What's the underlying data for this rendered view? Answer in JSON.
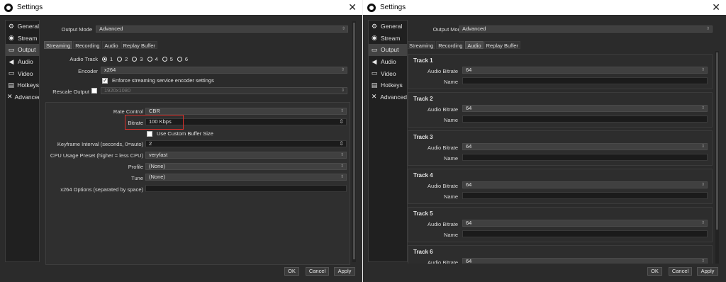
{
  "left": {
    "title": "Settings",
    "close_glyph": "✕",
    "sidebar": [
      {
        "label": "General",
        "icon": "gear-icon"
      },
      {
        "label": "Stream",
        "icon": "broadcast-icon"
      },
      {
        "label": "Output",
        "icon": "output-icon"
      },
      {
        "label": "Audio",
        "icon": "speaker-icon"
      },
      {
        "label": "Video",
        "icon": "monitor-icon"
      },
      {
        "label": "Hotkeys",
        "icon": "keyboard-icon"
      },
      {
        "label": "Advanced",
        "icon": "tools-icon"
      }
    ],
    "output_mode_label": "Output Mode",
    "output_mode_value": "Advanced",
    "tabs": [
      "Streaming",
      "Recording",
      "Audio",
      "Replay Buffer"
    ],
    "audio_track_label": "Audio Track",
    "audio_tracks": [
      "1",
      "2",
      "3",
      "4",
      "5",
      "6"
    ],
    "encoder_label": "Encoder",
    "encoder_value": "x264",
    "enforce_label": "Enforce streaming service encoder settings",
    "rescale_label": "Rescale Output",
    "rescale_value": "1920x1080",
    "rate_control_label": "Rate Control",
    "rate_control_value": "CBR",
    "bitrate_label": "Bitrate",
    "bitrate_value": "100 Kbps",
    "custom_buffer_label": "Use Custom Buffer Size",
    "keyframe_label": "Keyframe Interval (seconds, 0=auto)",
    "keyframe_value": "2",
    "cpu_preset_label": "CPU Usage Preset (higher = less CPU)",
    "cpu_preset_value": "veryfast",
    "profile_label": "Profile",
    "profile_value": "(None)",
    "tune_label": "Tune",
    "tune_value": "(None)",
    "x264_options_label": "x264 Options (separated by space)",
    "x264_options_value": "",
    "ok_label": "OK",
    "cancel_label": "Cancel",
    "apply_label": "Apply"
  },
  "right": {
    "title": "Settings",
    "close_glyph": "✕",
    "sidebar": [
      {
        "label": "General",
        "icon": "gear-icon"
      },
      {
        "label": "Stream",
        "icon": "broadcast-icon"
      },
      {
        "label": "Output",
        "icon": "output-icon"
      },
      {
        "label": "Audio",
        "icon": "speaker-icon"
      },
      {
        "label": "Video",
        "icon": "monitor-icon"
      },
      {
        "label": "Hotkeys",
        "icon": "keyboard-icon"
      },
      {
        "label": "Advanced",
        "icon": "tools-icon"
      }
    ],
    "output_mode_label": "Output Mode",
    "output_mode_value": "Advanced",
    "tabs": [
      "Streaming",
      "Recording",
      "Audio",
      "Replay Buffer"
    ],
    "audio_bitrate_label": "Audio Bitrate",
    "name_label": "Name",
    "tracks": [
      {
        "title": "Track 1",
        "bitrate": "64",
        "name": ""
      },
      {
        "title": "Track 2",
        "bitrate": "64",
        "name": ""
      },
      {
        "title": "Track 3",
        "bitrate": "64",
        "name": ""
      },
      {
        "title": "Track 4",
        "bitrate": "64",
        "name": ""
      },
      {
        "title": "Track 5",
        "bitrate": "64",
        "name": ""
      },
      {
        "title": "Track 6",
        "bitrate": "64",
        "name": ""
      }
    ],
    "ok_label": "OK",
    "cancel_label": "Cancel",
    "apply_label": "Apply"
  }
}
